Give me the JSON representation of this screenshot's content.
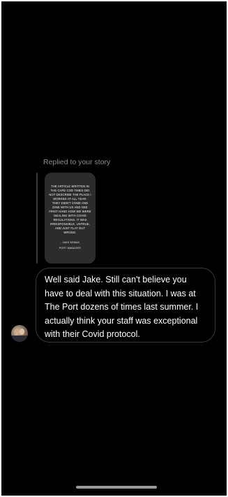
{
  "reply": {
    "label": "Replied to your story"
  },
  "story": {
    "text": "THE ARTICLE WRITTEN IN THE CAPE COD TIMES DID NOT DESCRIBE THE PLACE I WORKED AT ALL YEAR. THEY DIDN'T COME AND DINE WITH US AND SEE FIRST HAND HOW WE WERE DEALING WITH COVID REGULATIONS. IT WAS IRRESPONSIBLE, UNTRUE, AND JUST FLAT OUT WRONG.",
    "signature": "- JAKE DEMAS",
    "role": "PORT MANAGER"
  },
  "message": {
    "text": "Well said Jake. Still can't believe you have to deal with this situation. I was at The Port dozens of times last summer. I actually think your staff was exceptional with their Covid protocol."
  },
  "colors": {
    "background": "#000000",
    "bubble_border": "#3a3a3a",
    "secondary_text": "#8e8e8e"
  },
  "icons": {
    "avatar": "sender-avatar-photo"
  }
}
